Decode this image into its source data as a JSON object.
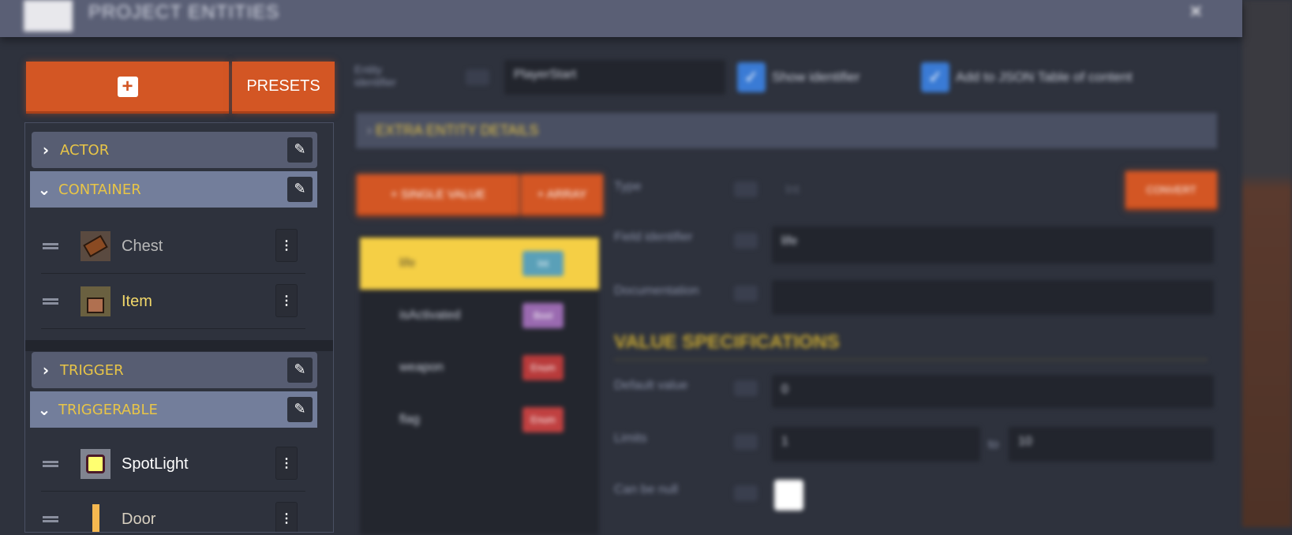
{
  "header": {
    "title": "PROJECT ENTITIES",
    "close_icon": "close-icon"
  },
  "sidebar": {
    "add_label": "+",
    "presets_label": "PRESETS",
    "tags": [
      {
        "label": "ACTOR",
        "expanded": false
      },
      {
        "label": "CONTAINER",
        "expanded": true,
        "entities": [
          {
            "name": "Chest",
            "color": "#b8b8b8"
          },
          {
            "name": "Item",
            "color": "#f2d86a"
          }
        ]
      },
      {
        "label": "TRIGGER",
        "expanded": false
      },
      {
        "label": "TRIGGERABLE",
        "expanded": true,
        "entities": [
          {
            "name": "SpotLight",
            "color": "#ffffff"
          },
          {
            "name": "Door",
            "color": "#d8d0c0"
          }
        ]
      }
    ]
  },
  "entity": {
    "identifier_label": "Entity identifier",
    "identifier_value": "PlayerStart",
    "show_identifier_label": "Show identifier",
    "show_identifier_checked": true,
    "json_toc_label": "Add to JSON Table of content",
    "json_toc_checked": true,
    "extra_details_label": "EXTRA ENTITY DETAILS"
  },
  "fields": {
    "single_value_label": "+ SINGLE VALUE",
    "array_label": "+ ARRAY",
    "items": [
      {
        "name": "life",
        "type": "Int",
        "color": "#5aa0b8",
        "selected": true
      },
      {
        "name": "isActivated",
        "type": "Bool",
        "color": "#9a6ab0"
      },
      {
        "name": "weapon",
        "type": "Enum",
        "color": "#b83a3a"
      },
      {
        "name": "flag",
        "type": "Enum",
        "color": "#c04040"
      }
    ]
  },
  "form": {
    "type_label": "Type",
    "type_value": "Int",
    "convert_label": "CONVERT",
    "field_identifier_label": "Field identifier",
    "field_identifier_value": "life",
    "documentation_label": "Documentation",
    "documentation_value": "",
    "value_spec_label": "VALUE SPECIFICATIONS",
    "default_value_label": "Default value",
    "default_value": "0",
    "limits_label": "Limits",
    "limit_min": "1",
    "limit_to": "to",
    "limit_max": "10",
    "can_be_null_label": "Can be null",
    "can_be_null_checked": false
  }
}
